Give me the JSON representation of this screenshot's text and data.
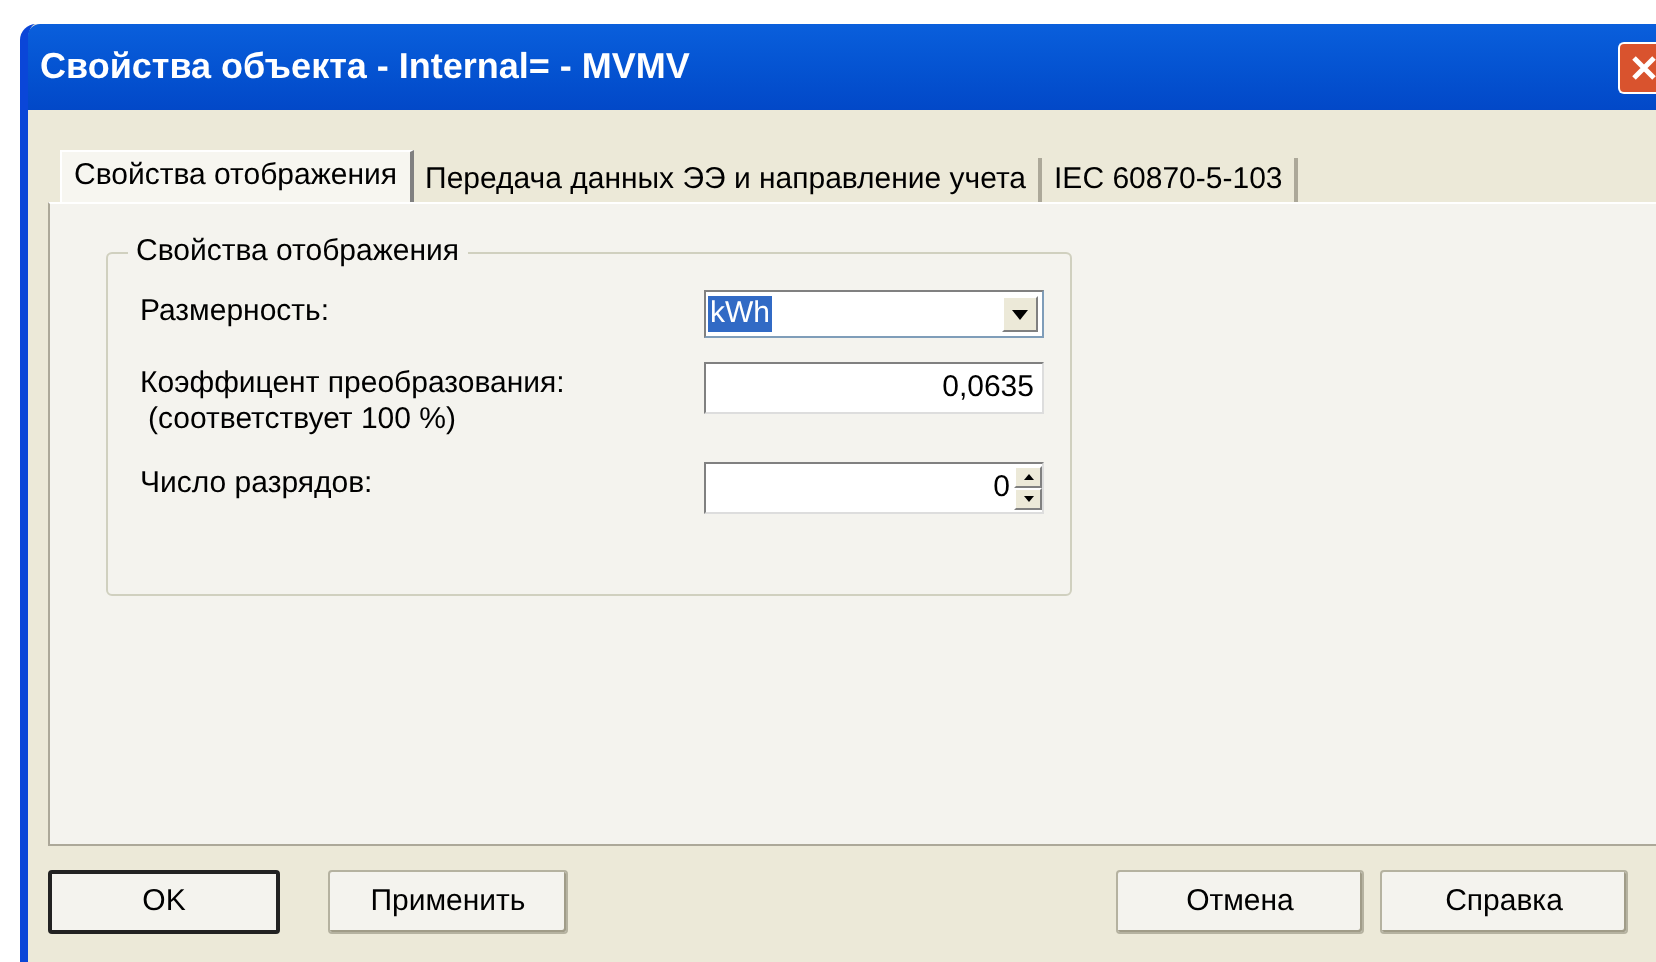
{
  "window": {
    "title": "Свойства объекта - Internal= - MVMV"
  },
  "tabs": [
    {
      "label": "Свойства отображения",
      "selected": true
    },
    {
      "label": "Передача данных ЭЭ и направление учета",
      "selected": false
    },
    {
      "label": "IEC 60870-5-103",
      "selected": false
    }
  ],
  "group": {
    "title": "Свойства отображения",
    "fields": [
      {
        "kind": "dropdown",
        "label": "Размерность:",
        "value": "kWh",
        "value_selected": true
      },
      {
        "kind": "text",
        "label": "Коэффицент преобразования:",
        "note": "(соответствует 100 %)",
        "value": "0,0635"
      },
      {
        "kind": "spinner",
        "label": "Число разрядов:",
        "value": "0"
      }
    ]
  },
  "buttons": [
    {
      "label": "OK",
      "default": true
    },
    {
      "label": "Применить",
      "default": false
    },
    {
      "label": "Отмена",
      "default": false
    },
    {
      "label": "Справка",
      "default": false
    }
  ]
}
